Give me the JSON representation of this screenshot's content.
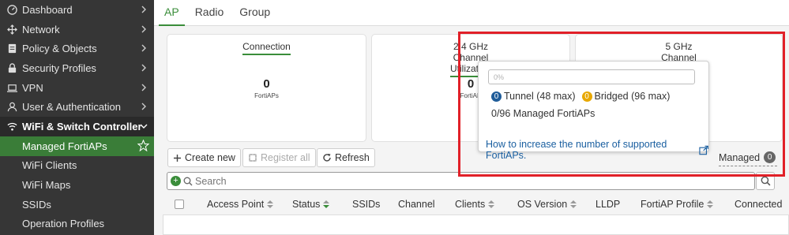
{
  "sidebar": {
    "items": [
      {
        "label": "Dashboard",
        "icon": "dashboard-icon"
      },
      {
        "label": "Network",
        "icon": "network-icon"
      },
      {
        "label": "Policy & Objects",
        "icon": "policy-icon"
      },
      {
        "label": "Security Profiles",
        "icon": "lock-icon"
      },
      {
        "label": "VPN",
        "icon": "laptop-icon"
      },
      {
        "label": "User & Authentication",
        "icon": "user-icon"
      },
      {
        "label": "WiFi & Switch Controller",
        "icon": "wifi-icon"
      }
    ],
    "subitems": [
      {
        "label": "Managed FortiAPs"
      },
      {
        "label": "WiFi Clients"
      },
      {
        "label": "WiFi Maps"
      },
      {
        "label": "SSIDs"
      },
      {
        "label": "Operation Profiles"
      }
    ]
  },
  "tabs": [
    {
      "label": "AP"
    },
    {
      "label": "Radio"
    },
    {
      "label": "Group"
    }
  ],
  "cards": {
    "connection": {
      "title": "Connection",
      "value": "0",
      "unit": "FortiAPs"
    },
    "ghz24": {
      "line1": "2.4 GHz",
      "line2": "Channel",
      "line3": "Utilization",
      "value": "0",
      "unit": "FortiAP"
    },
    "ghz5": {
      "line1": "5 GHz",
      "line2": "Channel"
    }
  },
  "toolbar": {
    "create_new": "Create new",
    "register_all": "Register all",
    "refresh": "Refresh",
    "managed_label": "Managed",
    "managed_count": "0"
  },
  "search": {
    "placeholder": "Search"
  },
  "columns": [
    "Access Point",
    "Status",
    "SSIDs",
    "Channel",
    "Clients",
    "OS Version",
    "LLDP",
    "FortiAP Profile",
    "Connected"
  ],
  "popup": {
    "progress_text": "0%",
    "progress_value": 0,
    "tunnel_count": "0",
    "tunnel_label": "Tunnel (48 max)",
    "bridged_count": "0",
    "bridged_label": "Bridged (96 max)",
    "managed_text": "0/96 Managed FortiAPs",
    "link": "How to increase the number of supported FortiAPs."
  },
  "colors": {
    "accent": "#3a8d3a",
    "sidebar_bg": "#363636",
    "tunnel": "#1f5c99",
    "bridged": "#e8a800",
    "highlight": "#e12028",
    "link": "#1a5fa0"
  }
}
